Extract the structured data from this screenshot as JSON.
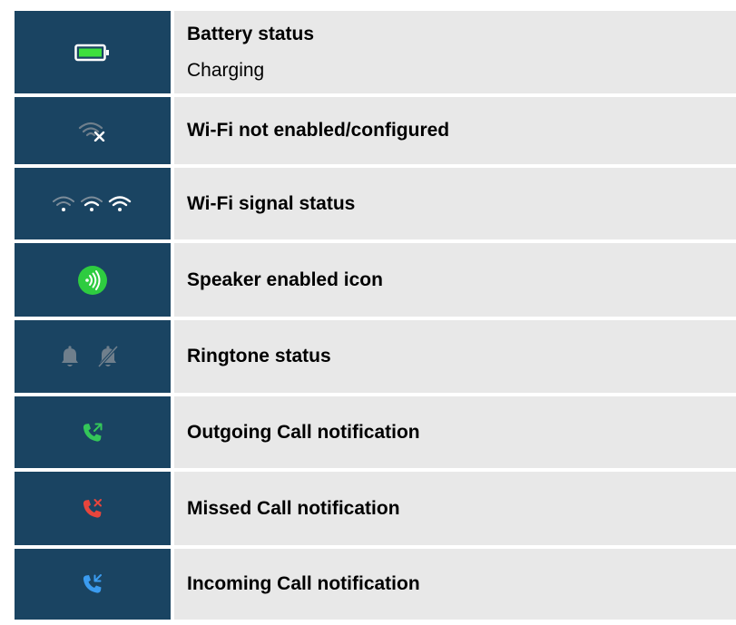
{
  "rows": [
    {
      "icon": "battery-charging-icon",
      "title": "Battery status",
      "subtitle": "Charging"
    },
    {
      "icon": "wifi-disabled-icon",
      "title": "Wi-Fi not enabled/configured"
    },
    {
      "icon": "wifi-signal-icon",
      "title": "Wi-Fi signal status"
    },
    {
      "icon": "speaker-icon",
      "title": "Speaker enabled icon"
    },
    {
      "icon": "bell-icon",
      "title": "Ringtone status"
    },
    {
      "icon": "outgoing-call-icon",
      "title": "Outgoing Call notification"
    },
    {
      "icon": "missed-call-icon",
      "title": "Missed Call notification"
    },
    {
      "icon": "incoming-call-icon",
      "title": "Incoming Call notification"
    }
  ],
  "colors": {
    "icon_background": "#1a4462",
    "description_background": "#e8e8e8",
    "battery_fill": "#3ee03e",
    "speaker_green": "#2ecc40",
    "outgoing_green": "#34c759",
    "missed_red": "#e8453c",
    "incoming_blue": "#3b9cf0",
    "muted_gray": "#6f7f8c"
  }
}
